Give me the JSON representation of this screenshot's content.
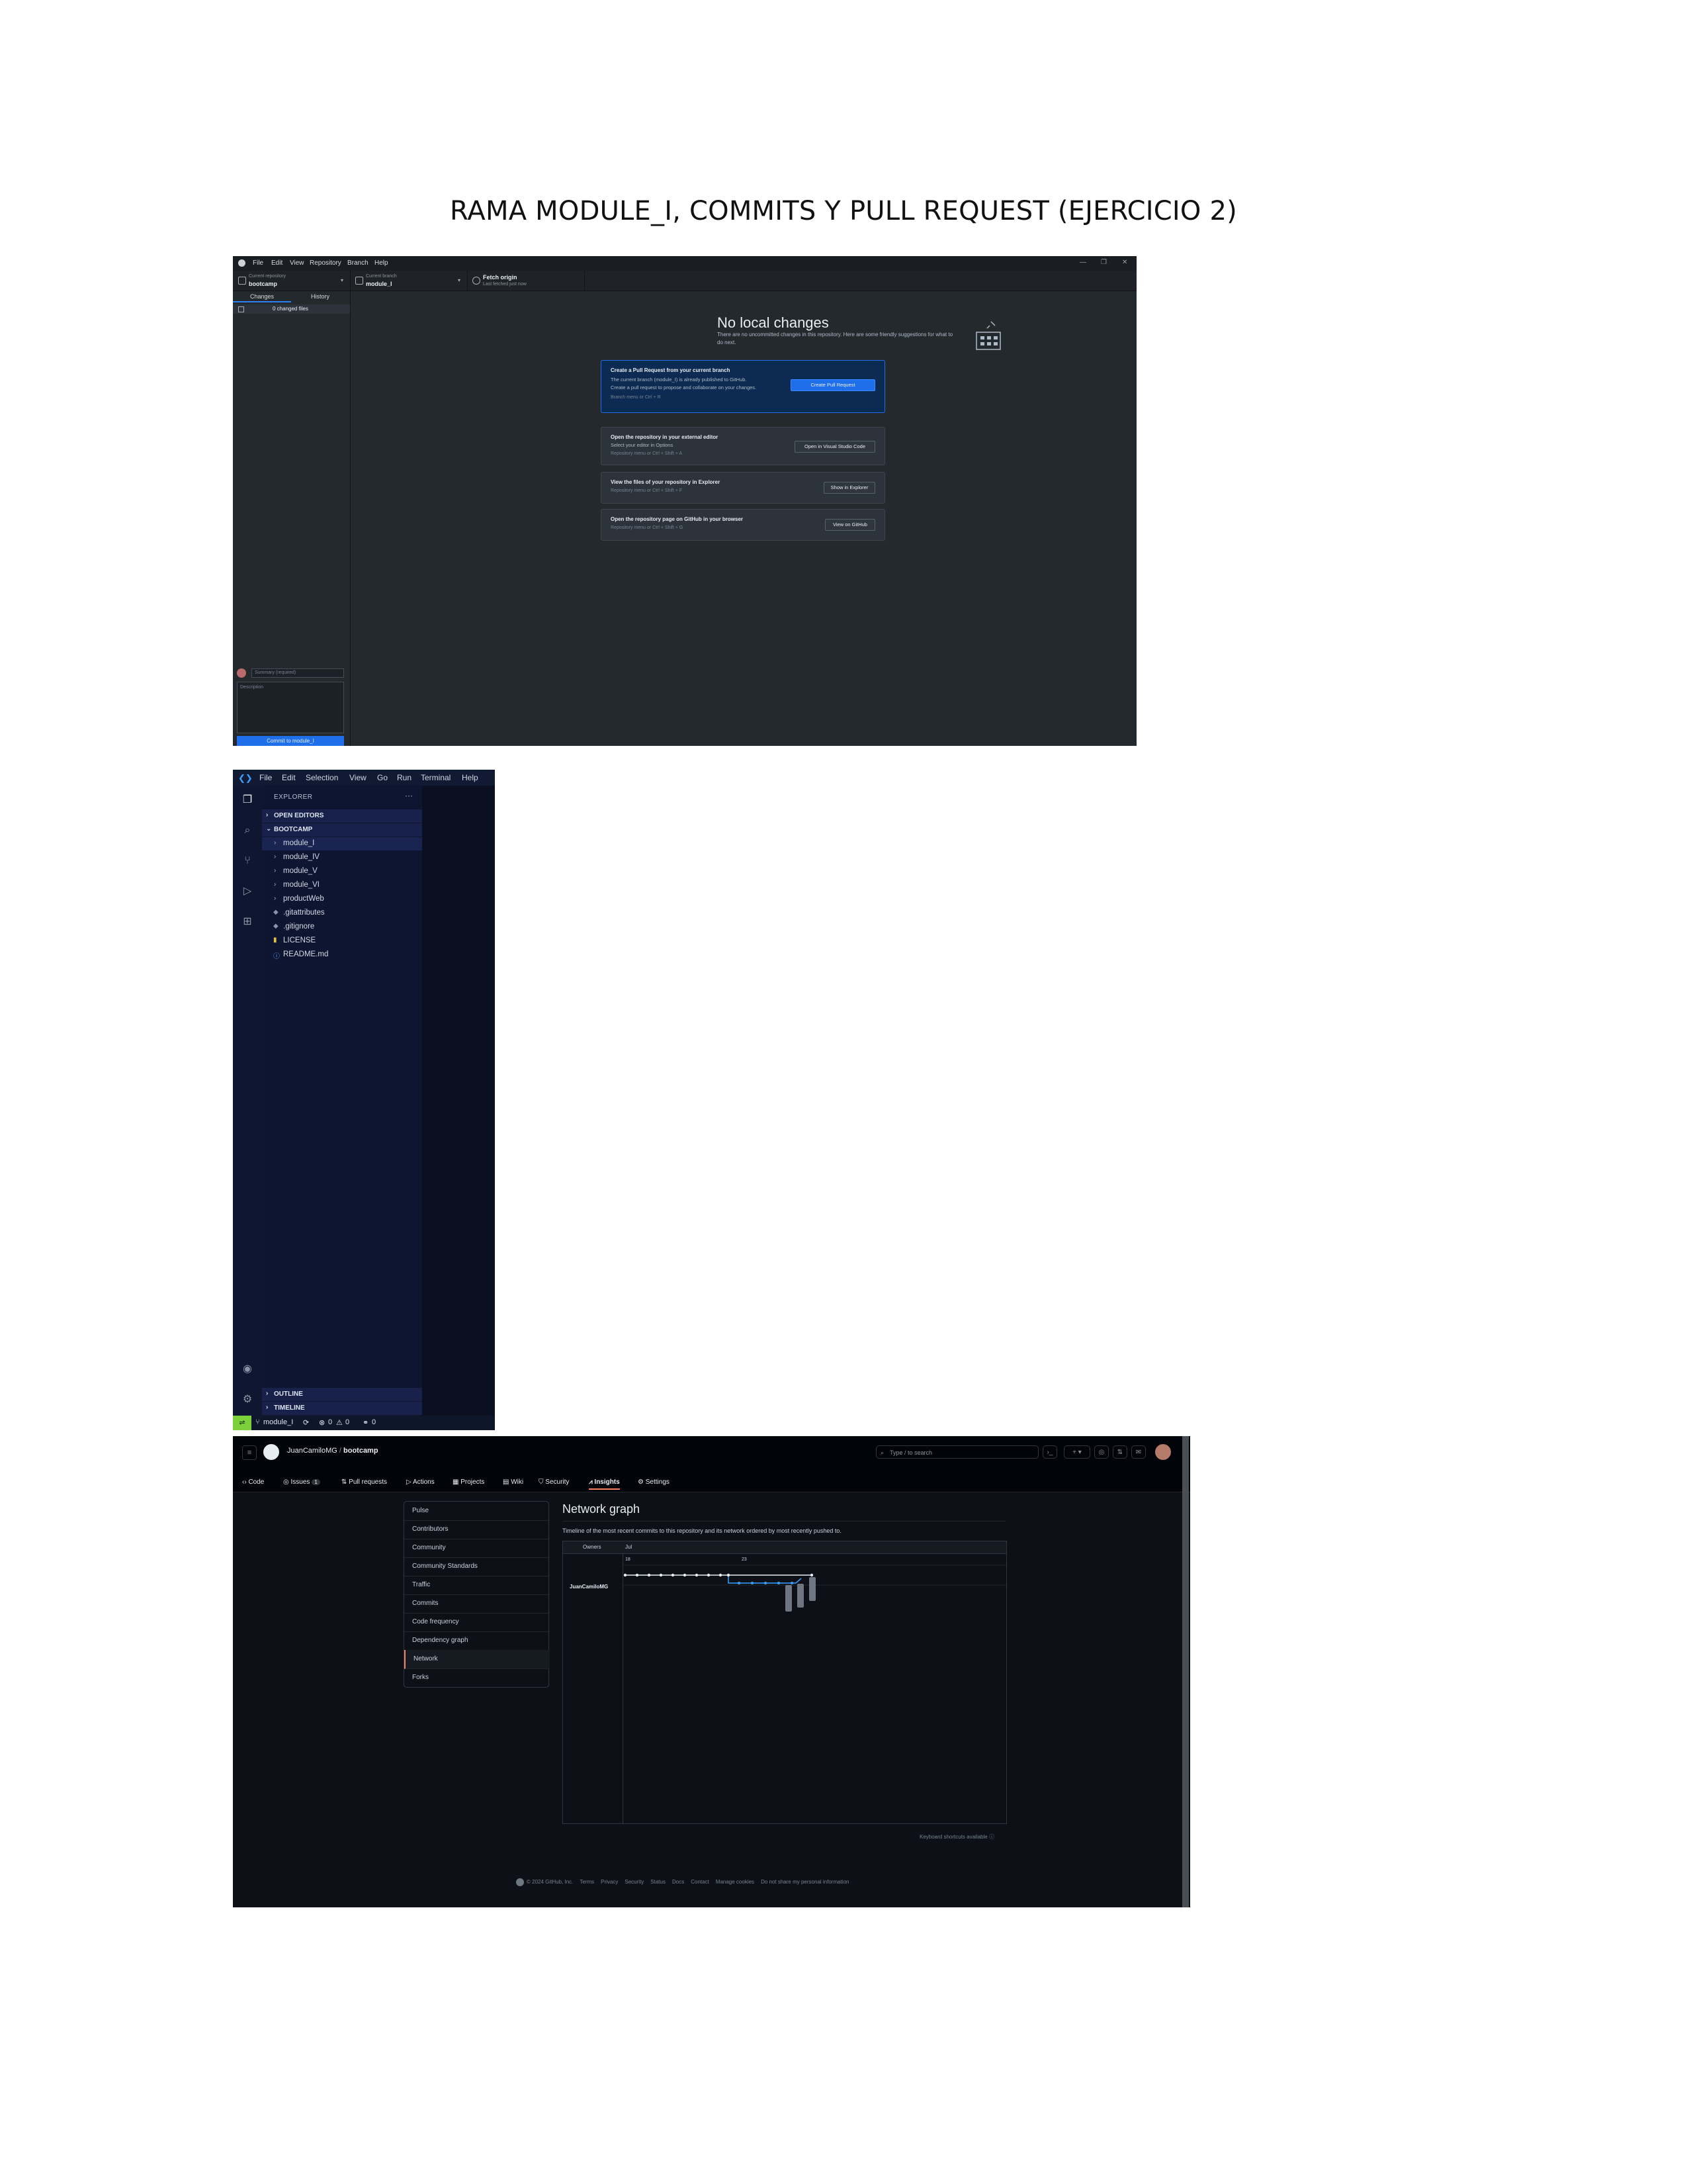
{
  "document": {
    "title": "RAMA MODULE_I, COMMITS Y PULL REQUEST (EJERCICIO 2)"
  },
  "github_desktop": {
    "menu": [
      "File",
      "Edit",
      "View",
      "Repository",
      "Branch",
      "Help"
    ],
    "window_controls": [
      "—",
      "❐",
      "✕"
    ],
    "current_repository": {
      "label": "Current repository",
      "value": "bootcamp"
    },
    "current_branch": {
      "label": "Current branch",
      "value": "module_I"
    },
    "fetch": {
      "label": "Fetch origin",
      "sub": "Last fetched just now"
    },
    "tabs": {
      "changes": "Changes",
      "history": "History"
    },
    "changed_files": "0 changed files",
    "no_changes": {
      "title": "No local changes",
      "subtitle": "There are no uncommitted changes in this repository. Here are some friendly suggestions for what to do next."
    },
    "cards": {
      "pr": {
        "title": "Create a Pull Request from your current branch",
        "line1": "The current branch (module_I) is already published to GitHub.",
        "line2": "Create a pull request to propose and collaborate on your changes.",
        "shortcut": "Branch menu or  Ctrl + R",
        "button": "Create Pull Request"
      },
      "editor": {
        "title": "Open the repository in your external editor",
        "line1": "Select your editor in Options",
        "shortcut": "Repository menu or  Ctrl + Shift + A",
        "button": "Open in Visual Studio Code"
      },
      "explorer": {
        "title": "View the files of your repository in Explorer",
        "shortcut": "Repository menu or  Ctrl + Shift + F",
        "button": "Show in Explorer"
      },
      "browser": {
        "title": "Open the repository page on GitHub in your browser",
        "shortcut": "Repository menu or  Ctrl + Shift + G",
        "button": "View on GitHub"
      }
    },
    "commit": {
      "summary_placeholder": "Summary (required)",
      "description_placeholder": "Description",
      "button": "Commit to module_I"
    }
  },
  "vscode": {
    "menu": [
      "File",
      "Edit",
      "Selection",
      "View",
      "Go",
      "Run",
      "Terminal",
      "Help"
    ],
    "explorer_title": "EXPLORER",
    "sections": {
      "open_editors": "OPEN EDITORS",
      "workspace": "BOOTCAMP",
      "outline": "OUTLINE",
      "timeline": "TIMELINE"
    },
    "tree": [
      {
        "name": "module_I",
        "kind": "folder"
      },
      {
        "name": "module_IV",
        "kind": "folder"
      },
      {
        "name": "module_V",
        "kind": "folder"
      },
      {
        "name": "module_VI",
        "kind": "folder"
      },
      {
        "name": "productWeb",
        "kind": "folder"
      },
      {
        "name": ".gitattributes",
        "kind": "file"
      },
      {
        "name": ".gitignore",
        "kind": "file"
      },
      {
        "name": "LICENSE",
        "kind": "license"
      },
      {
        "name": "README.md",
        "kind": "info"
      }
    ],
    "status": {
      "branch": "module_I",
      "errors": "0",
      "warnings": "0",
      "ports": "0"
    }
  },
  "github_web": {
    "owner": "JuanCamiloMG",
    "repo": "bootcamp",
    "search_placeholder": "Type / to search",
    "tabs": [
      {
        "label": "Code"
      },
      {
        "label": "Issues",
        "count": "1"
      },
      {
        "label": "Pull requests"
      },
      {
        "label": "Actions"
      },
      {
        "label": "Projects"
      },
      {
        "label": "Wiki"
      },
      {
        "label": "Security"
      },
      {
        "label": "Insights",
        "active": true
      },
      {
        "label": "Settings"
      }
    ],
    "insights_menu": [
      "Pulse",
      "Contributors",
      "Community",
      "Community Standards",
      "Traffic",
      "Commits",
      "Code frequency",
      "Dependency graph",
      "Network",
      "Forks"
    ],
    "active_menu": "Network",
    "network": {
      "title": "Network graph",
      "subtitle": "Timeline of the most recent commits to this repository and its network ordered by most recently pushed to.",
      "owners_label": "Owners",
      "month_label": "Jul",
      "dates": [
        "18",
        "23"
      ],
      "owner_row": "JuanCamiloMG"
    },
    "keyboard_hint": "Keyboard shortcuts available",
    "footer": [
      "© 2024 GitHub, Inc.",
      "Terms",
      "Privacy",
      "Security",
      "Status",
      "Docs",
      "Contact",
      "Manage cookies",
      "Do not share my personal information"
    ]
  }
}
